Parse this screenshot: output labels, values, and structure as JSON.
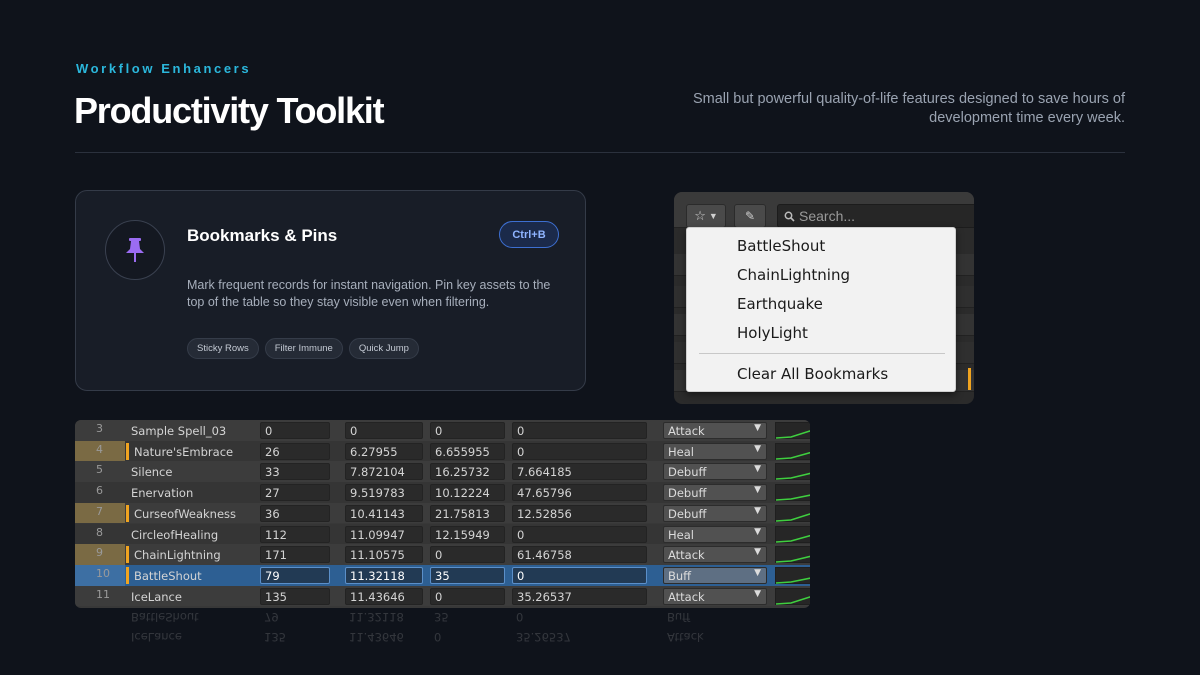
{
  "header": {
    "eyebrow": "Workflow Enhancers",
    "title": "Productivity Toolkit",
    "subtitle": "Small but powerful quality-of-life features designed to save hours of development time every week."
  },
  "card": {
    "icon": "pin-icon",
    "title": "Bookmarks & Pins",
    "shortcut": "Ctrl+B",
    "description": "Mark frequent records for instant navigation. Pin key assets to the top of the table so they stay visible even when filtering.",
    "tags": [
      "Sticky Rows",
      "Filter Immune",
      "Quick Jump"
    ]
  },
  "bookmark_panel": {
    "toolbar": {
      "star_icon": "star-icon",
      "caret_icon": "chevron-down-icon",
      "erase_icon": "eraser-icon",
      "search_icon": "search-icon",
      "search_placeholder": "Search..."
    },
    "menu_items": [
      "BattleShout",
      "ChainLightning",
      "Earthquake",
      "HolyLight"
    ],
    "clear_label": "Clear All Bookmarks"
  },
  "table": {
    "rows": [
      {
        "index": "3",
        "name": "Sample Spell_03",
        "c1": "0",
        "c2": "0",
        "c3": "0",
        "c4": "0",
        "type": "Attack",
        "bookmarked": false,
        "selected": false
      },
      {
        "index": "4",
        "name": "Nature'sEmbrace",
        "c1": "26",
        "c2": "6.27955",
        "c3": "6.655955",
        "c4": "0",
        "type": "Heal",
        "bookmarked": true,
        "selected": false
      },
      {
        "index": "5",
        "name": "Silence",
        "c1": "33",
        "c2": "7.872104",
        "c3": "16.25732",
        "c4": "7.664185",
        "type": "Debuff",
        "bookmarked": false,
        "selected": false
      },
      {
        "index": "6",
        "name": "Enervation",
        "c1": "27",
        "c2": "9.519783",
        "c3": "10.12224",
        "c4": "47.65796",
        "type": "Debuff",
        "bookmarked": false,
        "selected": false
      },
      {
        "index": "7",
        "name": "CurseofWeakness",
        "c1": "36",
        "c2": "10.41143",
        "c3": "21.75813",
        "c4": "12.52856",
        "type": "Debuff",
        "bookmarked": true,
        "selected": false
      },
      {
        "index": "8",
        "name": "CircleofHealing",
        "c1": "112",
        "c2": "11.09947",
        "c3": "12.15949",
        "c4": "0",
        "type": "Heal",
        "bookmarked": false,
        "selected": false
      },
      {
        "index": "9",
        "name": "ChainLightning",
        "c1": "171",
        "c2": "11.10575",
        "c3": "0",
        "c4": "61.46758",
        "type": "Attack",
        "bookmarked": true,
        "selected": false
      },
      {
        "index": "10",
        "name": "BattleShout",
        "c1": "79",
        "c2": "11.32118",
        "c3": "35",
        "c4": "0",
        "type": "Buff",
        "bookmarked": true,
        "selected": true
      },
      {
        "index": "11",
        "name": "IceLance",
        "c1": "135",
        "c2": "11.43646",
        "c3": "0",
        "c4": "35.26537",
        "type": "Attack",
        "bookmarked": false,
        "selected": false
      }
    ]
  },
  "colors": {
    "accent": "#2bb7dc",
    "bookmark": "#f0a420",
    "selection": "#2d5f93",
    "pin": "#9b6cf2"
  }
}
